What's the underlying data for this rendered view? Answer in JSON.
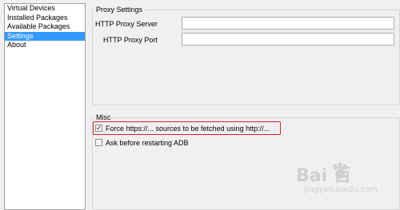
{
  "sidebar": {
    "items": [
      {
        "label": "Virtual Devices"
      },
      {
        "label": "Installed Packages"
      },
      {
        "label": "Available Packages"
      },
      {
        "label": "Settings",
        "selected": true
      },
      {
        "label": "About"
      }
    ]
  },
  "proxy": {
    "title": "Proxy Settings",
    "server_label": "HTTP Proxy Server",
    "server_value": "",
    "port_label": "HTTP Proxy Port",
    "port_value": ""
  },
  "misc": {
    "title": "Misc",
    "force_https_label": "Force https://... sources to be fetched using http://...",
    "force_https_checked": true,
    "ask_restart_label": "Ask before restarting ADB",
    "ask_restart_checked": false
  },
  "watermark": {
    "logo_text": "Bai  百",
    "sub_text": "jingyan.baidu.com"
  },
  "colors": {
    "selection": "#3399ff",
    "highlight": "#e02020"
  }
}
